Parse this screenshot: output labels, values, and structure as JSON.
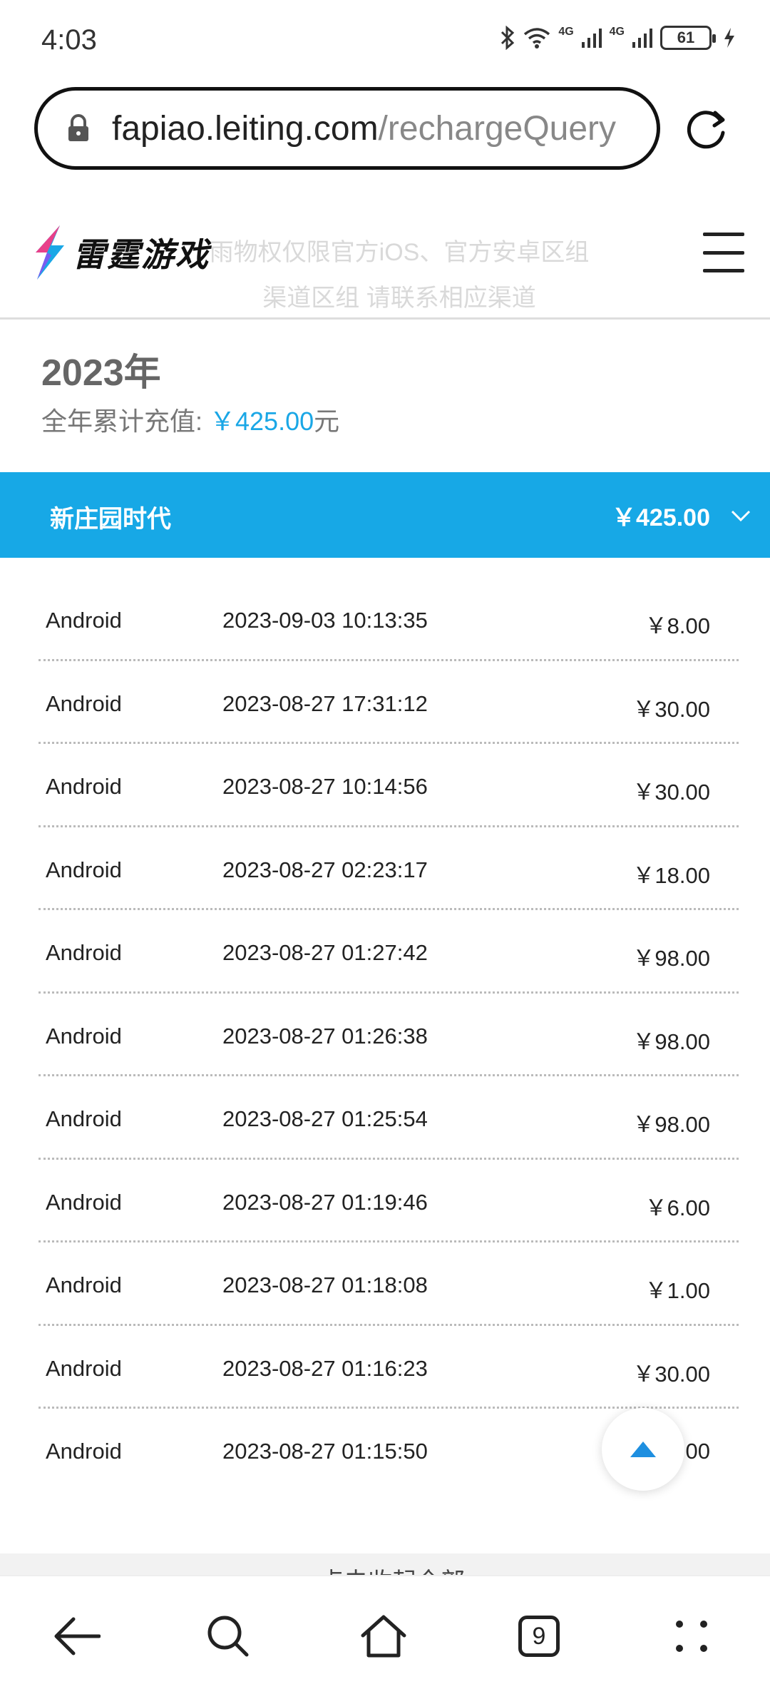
{
  "status_bar": {
    "time": "4:03",
    "network_1": "4G",
    "network_2": "4G",
    "battery": "61"
  },
  "browser": {
    "url_host": "fapiao.leiting.com",
    "url_path": "/rechargeQuery",
    "tab_count": "9"
  },
  "site": {
    "logo_text": "雷霆游戏",
    "notice_line1": "雨物权仅限官方iOS、官方安卓区组",
    "notice_line2": "渠道区组 请联系相应渠道"
  },
  "summary": {
    "year": "2023年",
    "total_label": "全年累计充值: ",
    "total_amount": "￥425.00",
    "total_unit": "元"
  },
  "game": {
    "name": "新庄园时代",
    "amount": "￥425.00"
  },
  "records": [
    {
      "platform": "Android",
      "time": "2023-09-03 10:13:35",
      "amount": "￥8.00"
    },
    {
      "platform": "Android",
      "time": "2023-08-27 17:31:12",
      "amount": "￥30.00"
    },
    {
      "platform": "Android",
      "time": "2023-08-27 10:14:56",
      "amount": "￥30.00"
    },
    {
      "platform": "Android",
      "time": "2023-08-27 02:23:17",
      "amount": "￥18.00"
    },
    {
      "platform": "Android",
      "time": "2023-08-27 01:27:42",
      "amount": "￥98.00"
    },
    {
      "platform": "Android",
      "time": "2023-08-27 01:26:38",
      "amount": "￥98.00"
    },
    {
      "platform": "Android",
      "time": "2023-08-27 01:25:54",
      "amount": "￥98.00"
    },
    {
      "platform": "Android",
      "time": "2023-08-27 01:19:46",
      "amount": "￥6.00"
    },
    {
      "platform": "Android",
      "time": "2023-08-27 01:18:08",
      "amount": "￥1.00"
    },
    {
      "platform": "Android",
      "time": "2023-08-27 01:16:23",
      "amount": "￥30.00"
    },
    {
      "platform": "Android",
      "time": "2023-08-27 01:15:50",
      "amount": "00"
    }
  ],
  "collapse_label": "点击收起全部",
  "colors": {
    "accent": "#17a8e6",
    "amount_blue": "#1aa7e6"
  }
}
